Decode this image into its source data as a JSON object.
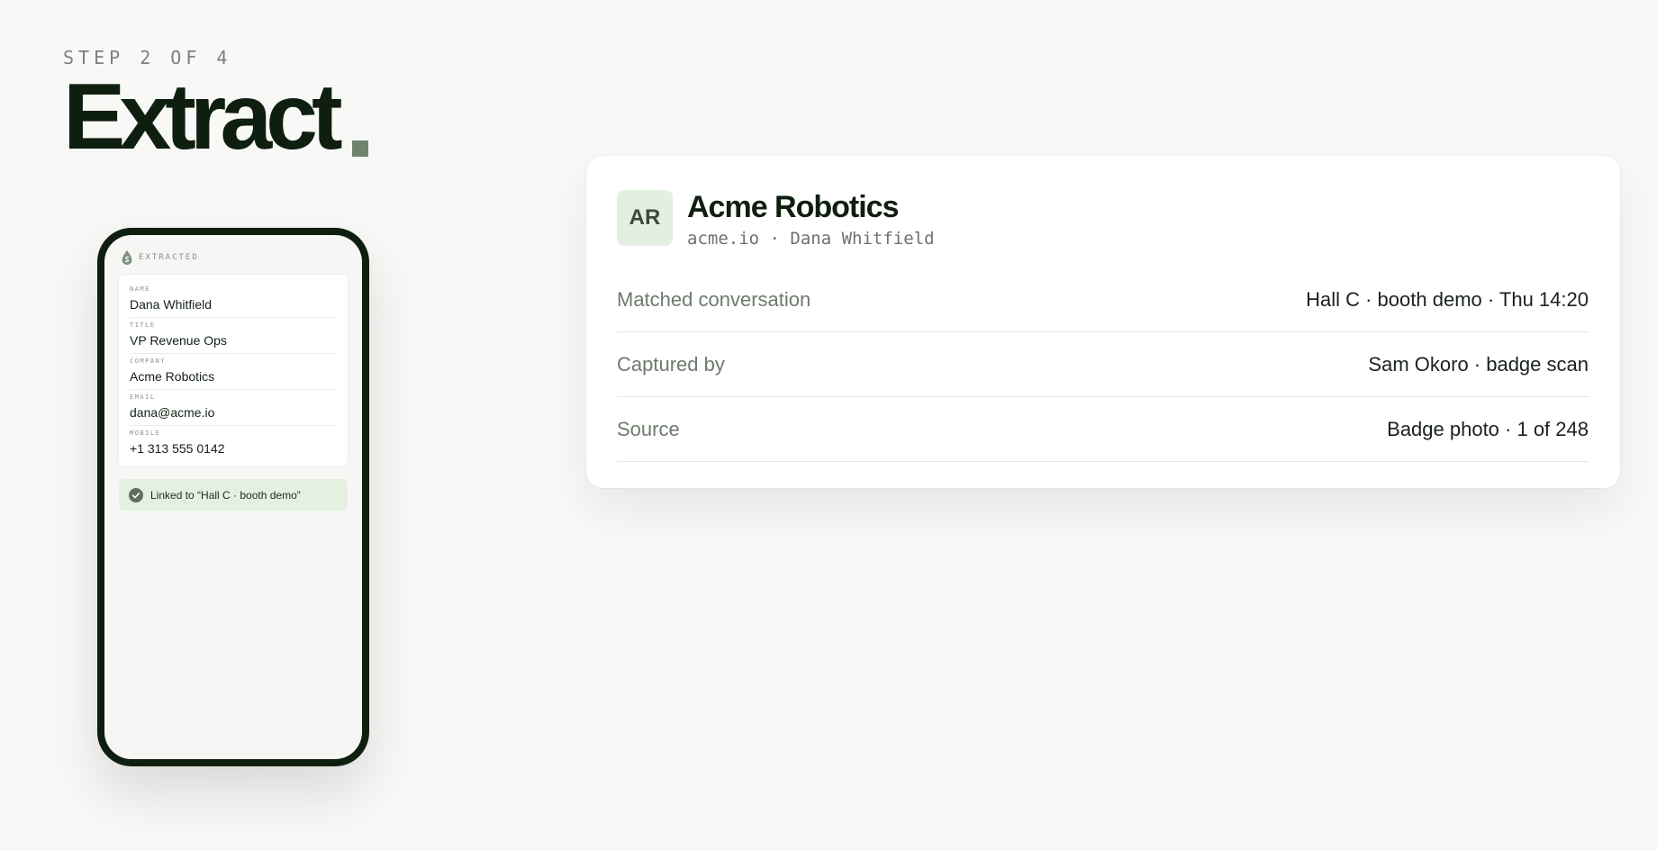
{
  "header": {
    "step": "STEP 2 OF 4",
    "title": "Extract"
  },
  "phone": {
    "label": "EXTRACTED",
    "fields": [
      {
        "key": "NAME",
        "value": "Dana Whitfield"
      },
      {
        "key": "TITLE",
        "value": "VP Revenue Ops"
      },
      {
        "key": "COMPANY",
        "value": "Acme Robotics"
      },
      {
        "key": "EMAIL",
        "value": "dana@acme.io"
      },
      {
        "key": "MOBILE",
        "value": "+1 313 555 0142"
      }
    ],
    "linked": "Linked to “Hall C · booth demo”"
  },
  "card": {
    "initials": "AR",
    "company": "Acme Robotics",
    "subtitle": "acme.io · Dana Whitfield",
    "rows": [
      {
        "label": "Matched conversation",
        "value": "Hall C · booth demo · Thu 14:20"
      },
      {
        "label": "Captured by",
        "value": "Sam Okoro · badge scan"
      },
      {
        "label": "Source",
        "value": "Badge photo · 1 of 248"
      }
    ]
  },
  "colors": {
    "ink": "#0f1f0f",
    "accent": "#6f846f",
    "mint": "#e3f0e1"
  },
  "icons": {
    "extracted": "drop-icon",
    "linked": "check-circle-icon"
  }
}
